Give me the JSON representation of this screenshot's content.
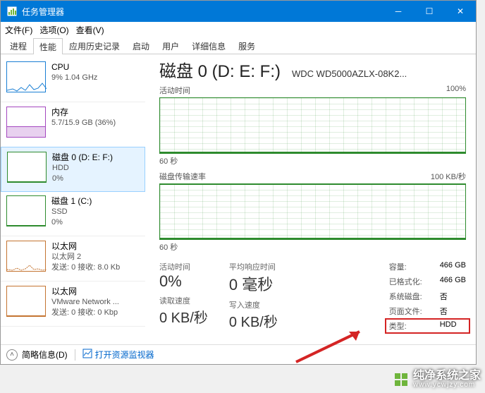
{
  "title": "任务管理器",
  "menu": {
    "file": "文件(F)",
    "options": "选项(O)",
    "view": "查看(V)"
  },
  "tabs": [
    "进程",
    "性能",
    "应用历史记录",
    "启动",
    "用户",
    "详细信息",
    "服务"
  ],
  "active_tab": "性能",
  "sidebar": {
    "items": [
      {
        "title": "CPU",
        "sub": "9%  1.04 GHz"
      },
      {
        "title": "内存",
        "sub": "5.7/15.9 GB (36%)"
      },
      {
        "title": "磁盘 0 (D: E: F:)",
        "sub1": "HDD",
        "sub2": "0%"
      },
      {
        "title": "磁盘 1 (C:)",
        "sub1": "SSD",
        "sub2": "0%"
      },
      {
        "title": "以太网",
        "sub1": "以太网 2",
        "sub2": "发送: 0  接收: 8.0 Kb"
      },
      {
        "title": "以太网",
        "sub1": "VMware Network ...",
        "sub2": "发送: 0  接收: 0 Kbp"
      }
    ]
  },
  "main": {
    "title": "磁盘 0 (D: E: F:)",
    "model": "WDC WD5000AZLX-08K2...",
    "chart1": {
      "label": "活动时间",
      "max": "100%",
      "xaxis": "60 秒"
    },
    "chart2": {
      "label": "磁盘传输速率",
      "max": "100 KB/秒",
      "xaxis": "60 秒"
    },
    "stats": {
      "active_time_label": "活动时间",
      "active_time": "0%",
      "avg_resp_label": "平均响应时间",
      "avg_resp": "0 毫秒",
      "read_label": "读取速度",
      "read": "0 KB/秒",
      "write_label": "写入速度",
      "write": "0 KB/秒",
      "capacity_k": "容量:",
      "capacity_v": "466 GB",
      "formatted_k": "已格式化:",
      "formatted_v": "466 GB",
      "sysdisk_k": "系统磁盘:",
      "sysdisk_v": "否",
      "pagefile_k": "页面文件:",
      "pagefile_v": "否",
      "type_k": "类型:",
      "type_v": "HDD"
    }
  },
  "footer": {
    "brief": "简略信息(D)",
    "resmon": "打开资源监视器"
  },
  "watermark": {
    "brand": "纯净系统之家",
    "url": "www.ycwjzy.com"
  },
  "chart_data": [
    {
      "type": "line",
      "title": "活动时间",
      "ylabel": "%",
      "ylim": [
        0,
        100
      ],
      "xlabel": "60 秒",
      "series": [
        {
          "name": "活动时间",
          "values": [
            0,
            0,
            0,
            0,
            0,
            0,
            0,
            0,
            0,
            0,
            0,
            0
          ]
        }
      ]
    },
    {
      "type": "line",
      "title": "磁盘传输速率",
      "ylabel": "KB/秒",
      "ylim": [
        0,
        100
      ],
      "xlabel": "60 秒",
      "series": [
        {
          "name": "传输速率",
          "values": [
            0,
            0,
            0,
            0,
            0,
            0,
            0,
            0,
            0,
            0,
            0,
            0
          ]
        }
      ]
    }
  ]
}
